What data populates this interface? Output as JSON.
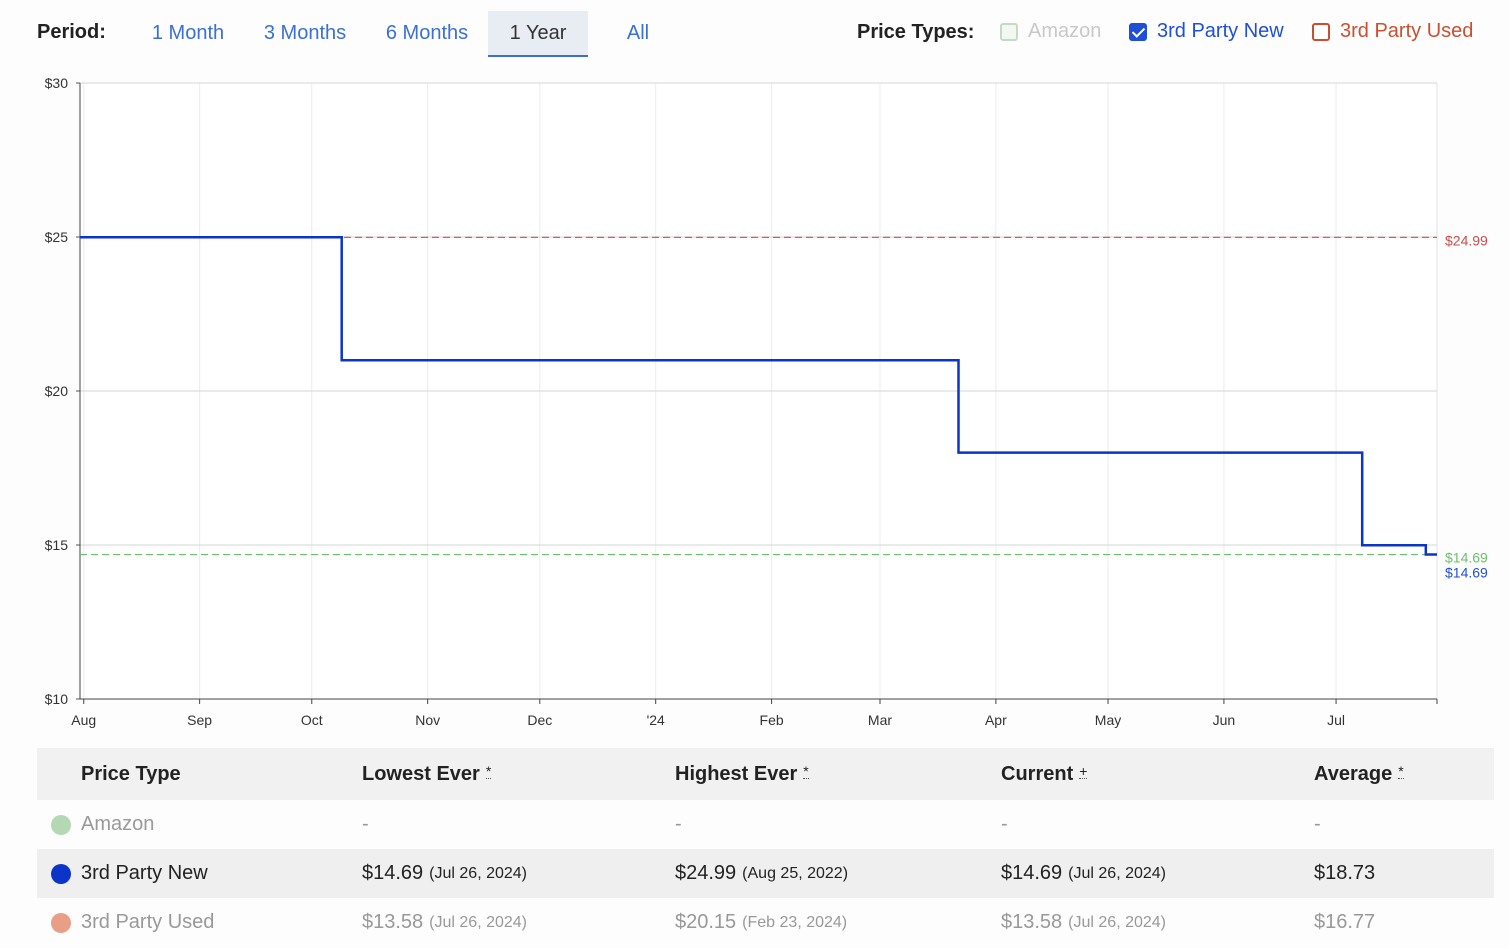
{
  "controls": {
    "period_label": "Period:",
    "periods": [
      "1 Month",
      "3 Months",
      "6 Months",
      "1 Year",
      "All"
    ],
    "active_period": "1 Year",
    "price_types_label": "Price Types:",
    "price_types": [
      {
        "label": "Amazon",
        "checked": false,
        "color": "#cfd8cf"
      },
      {
        "label": "3rd Party New",
        "checked": true,
        "color": "#1f4fd6"
      },
      {
        "label": "3rd Party Used",
        "checked": false,
        "color": "#c9502f"
      }
    ]
  },
  "chart_data": {
    "type": "line",
    "step": true,
    "y_ticks": [
      "$30",
      "$25",
      "$20",
      "$15",
      "$10"
    ],
    "ylim": [
      10,
      30
    ],
    "x_ticks": [
      "Aug",
      "Sep",
      "Oct",
      "Nov",
      "Dec",
      "'24",
      "Feb",
      "Mar",
      "Apr",
      "May",
      "Jun",
      "Jul"
    ],
    "x_range": [
      "2023-07-31",
      "2024-07-28"
    ],
    "series": [
      {
        "name": "3rd Party New",
        "color": "#0a35c8",
        "points": [
          {
            "date": "2023-07-31",
            "value": 24.99
          },
          {
            "date": "2023-10-09",
            "value": 24.99
          },
          {
            "date": "2023-10-09",
            "value": 21.0
          },
          {
            "date": "2024-03-22",
            "value": 21.0
          },
          {
            "date": "2024-03-22",
            "value": 18.0
          },
          {
            "date": "2024-07-08",
            "value": 18.0
          },
          {
            "date": "2024-07-08",
            "value": 14.99
          },
          {
            "date": "2024-07-25",
            "value": 14.99
          },
          {
            "date": "2024-07-25",
            "value": 14.69
          },
          {
            "date": "2024-07-28",
            "value": 14.69
          }
        ]
      }
    ],
    "reference_lines": [
      {
        "value": 24.99,
        "label": "$24.99",
        "color": "#c94b4b"
      },
      {
        "value": 14.69,
        "label": "$14.69",
        "color": "#6cbf6c"
      }
    ],
    "end_label": {
      "value": 14.69,
      "label": "$14.69",
      "color": "#1f4fd6"
    },
    "grid": true
  },
  "table": {
    "headers": [
      {
        "label": "Price Type",
        "mark": ""
      },
      {
        "label": "Lowest Ever",
        "mark": "*"
      },
      {
        "label": "Highest Ever",
        "mark": "*"
      },
      {
        "label": "Current",
        "mark": "+"
      },
      {
        "label": "Average",
        "mark": "*"
      }
    ],
    "rows": [
      {
        "name": "Amazon",
        "dot": "#b4d8b4",
        "lowest": "-",
        "lowest_date": "",
        "highest": "-",
        "highest_date": "",
        "current": "-",
        "current_date": "",
        "average": "-"
      },
      {
        "name": "3rd Party New",
        "dot": "#0a35c8",
        "lowest": "$14.69",
        "lowest_date": "(Jul 26, 2024)",
        "highest": "$24.99",
        "highest_date": "(Aug 25, 2022)",
        "current": "$14.69",
        "current_date": "(Jul 26, 2024)",
        "average": "$18.73"
      },
      {
        "name": "3rd Party Used",
        "dot": "#e89f86",
        "lowest": "$13.58",
        "lowest_date": "(Jul 26, 2024)",
        "highest": "$20.15",
        "highest_date": "(Feb 23, 2024)",
        "current": "$13.58",
        "current_date": "(Jul 26, 2024)",
        "average": "$16.77"
      }
    ]
  }
}
